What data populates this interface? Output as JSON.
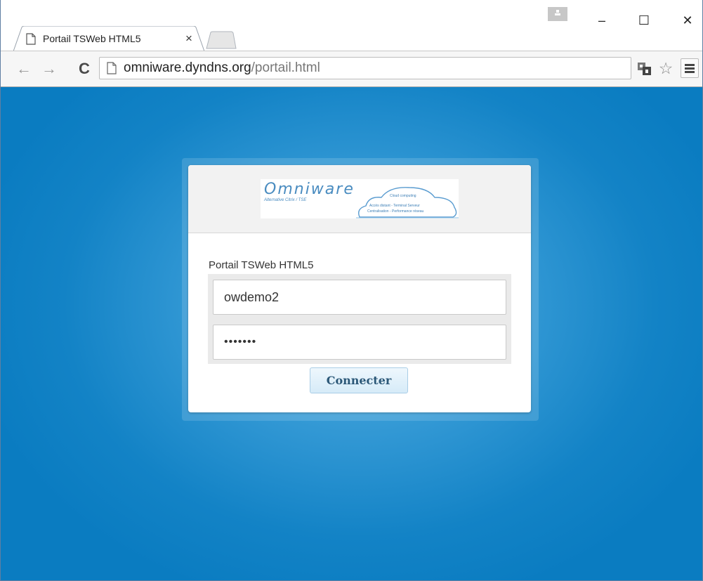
{
  "browser": {
    "tab": {
      "title": "Portail TSWeb HTML5",
      "close_glyph": "×"
    },
    "window_controls": {
      "minimize": "–",
      "maximize": "☐",
      "close": "✕"
    },
    "toolbar": {
      "back_glyph": "←",
      "forward_glyph": "→",
      "reload_glyph": "C",
      "url_host": "omniware.dyndns.org",
      "url_path": "/portail.html",
      "star_glyph": "☆"
    },
    "icons": [
      "page-icon",
      "close-icon",
      "profile-icon",
      "translate-icon",
      "star-icon",
      "menu-icon"
    ]
  },
  "page": {
    "background_color": "#1383c6",
    "logo": {
      "name": "Omniware",
      "tagline": "Alternative Citrix / TSE",
      "cloud_title": "Cloud computing",
      "cloud_line1": "Accès distant - Terminal Serveur",
      "cloud_line2": "Centralisation - Performance réseau"
    },
    "portal_title": "Portail TSWeb HTML5",
    "username_value": "owdemo2",
    "password_mask": "•••••••",
    "connect_label": "Connecter"
  }
}
